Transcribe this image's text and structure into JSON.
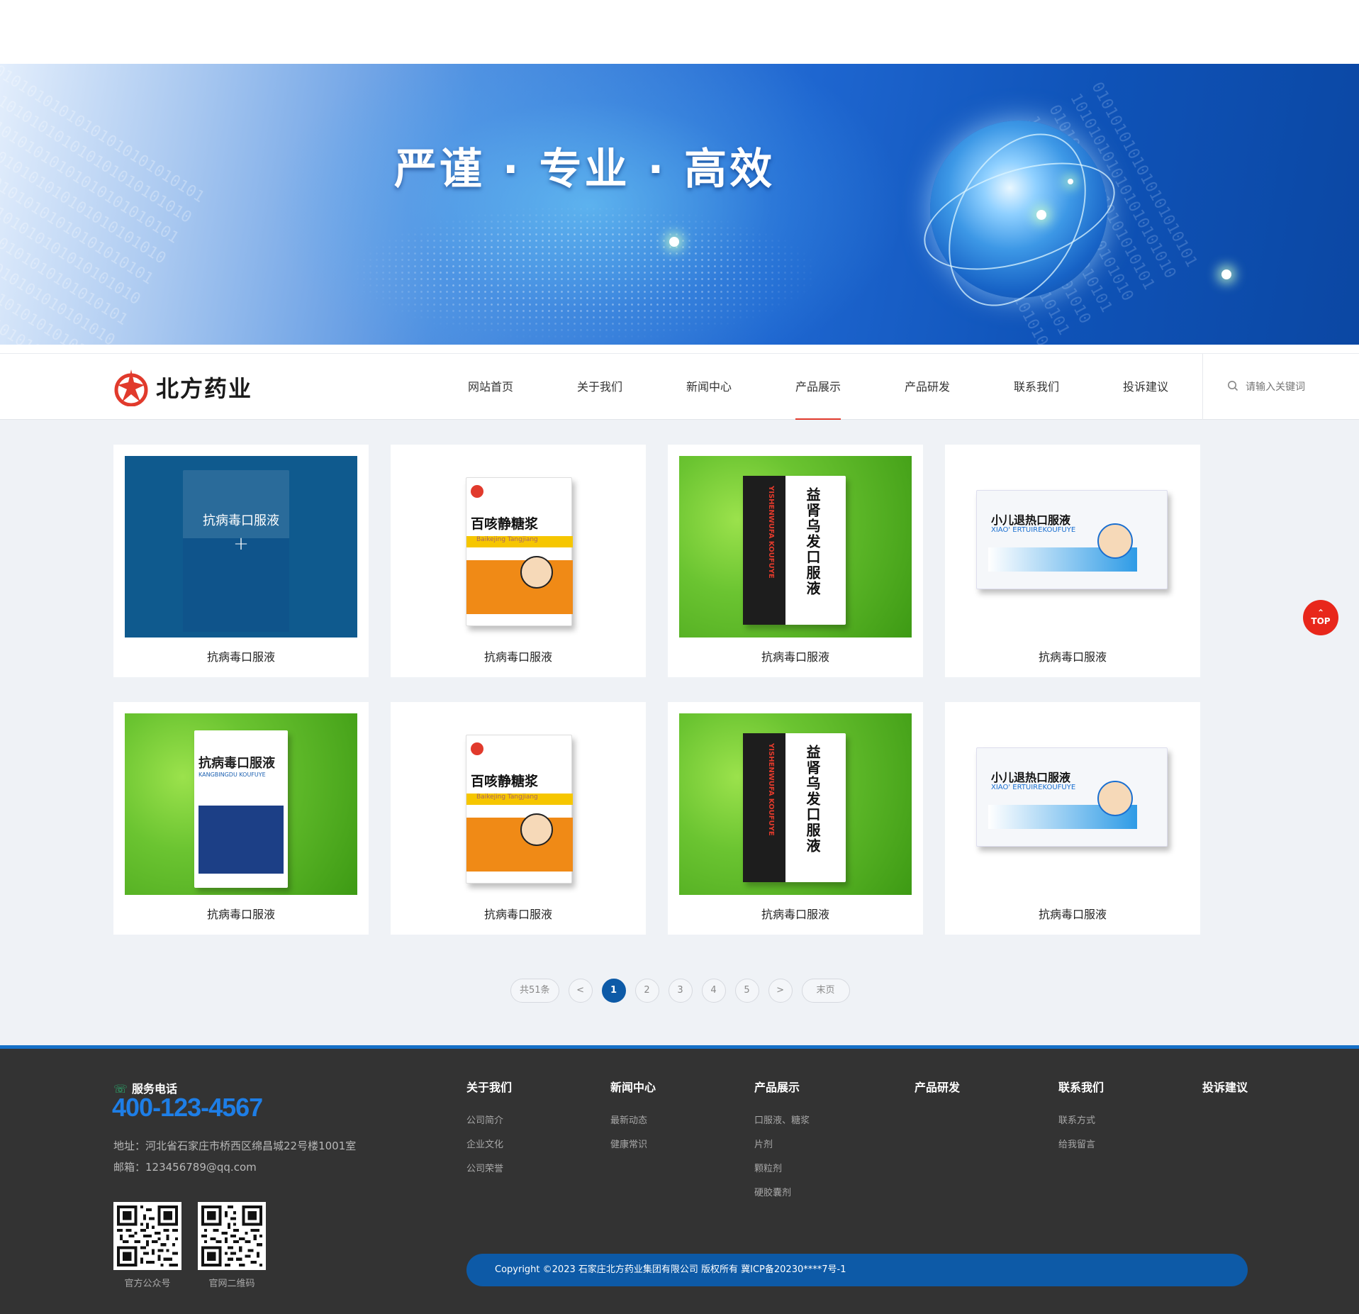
{
  "banner": {
    "slogan": "严谨 · 专业 · 高效"
  },
  "brand": {
    "name": "北方药业",
    "accent": "#e13a2c",
    "primary": "#0d5aa7"
  },
  "nav": {
    "items": [
      {
        "label": "网站首页"
      },
      {
        "label": "关于我们"
      },
      {
        "label": "新闻中心"
      },
      {
        "label": "产品展示",
        "active": true
      },
      {
        "label": "产品研发"
      },
      {
        "label": "联系我们"
      },
      {
        "label": "投诉建议"
      }
    ],
    "search_placeholder": "请输入关键词",
    "search_icon": "search-icon"
  },
  "products": [
    {
      "caption": "抗病毒口服液",
      "hover_title": "抗病毒口服液",
      "box_title": "抗病毒口服液",
      "hovered": true
    },
    {
      "caption": "抗病毒口服液",
      "box_title": "百咳静糖浆",
      "box_sub": "Baikejing Tangjiang"
    },
    {
      "caption": "抗病毒口服液",
      "box_title": "益肾乌发口服液",
      "box_sub": "YISHENWUFA KOUFUYE"
    },
    {
      "caption": "抗病毒口服液",
      "box_title": "小儿退热口服液",
      "box_sub": "XIAO' ERTUIREKOUFUYE"
    },
    {
      "caption": "抗病毒口服液",
      "box_title": "抗病毒口服液",
      "box_sub": "KANGBINGDU KOUFUYE"
    },
    {
      "caption": "抗病毒口服液",
      "box_title": "百咳静糖浆",
      "box_sub": "Baikejing Tangjiang"
    },
    {
      "caption": "抗病毒口服液",
      "box_title": "益肾乌发口服液",
      "box_sub": "YISHENWUFA KOUFUYE"
    },
    {
      "caption": "抗病毒口服液",
      "box_title": "小儿退热口服液",
      "box_sub": "XIAO' ERTUIREKOUFUYE"
    }
  ],
  "pagination": {
    "total": "共51条",
    "prev": "<",
    "pages": [
      "1",
      "2",
      "3",
      "4",
      "5"
    ],
    "current": "1",
    "next": ">",
    "last": "末页"
  },
  "back_to_top": "TOP",
  "footer": {
    "phone_label": "服务电话",
    "phone": "400-123-4567",
    "address": "地址：河北省石家庄市桥西区绵昌城22号楼1001室",
    "email": "邮箱：123456789@qq.com",
    "qr": [
      {
        "caption": "官方公众号"
      },
      {
        "caption": "官网二维码"
      }
    ],
    "columns": [
      {
        "title": "关于我们",
        "items": [
          "公司简介",
          "企业文化",
          "公司荣誉"
        ]
      },
      {
        "title": "新闻中心",
        "items": [
          "最新动态",
          "健康常识"
        ]
      },
      {
        "title": "产品展示",
        "items": [
          "口服液、糖浆",
          "片剂",
          "颗粒剂",
          "硬胶囊剂"
        ]
      },
      {
        "title": "产品研发",
        "items": []
      },
      {
        "title": "联系我们",
        "items": [
          "联系方式",
          "给我留言"
        ]
      },
      {
        "title": "投诉建议",
        "items": []
      }
    ],
    "copyright": "Copyright ©2023   石家庄北方药业集团有限公司   版权所有 冀ICP备20230****7号-1"
  }
}
